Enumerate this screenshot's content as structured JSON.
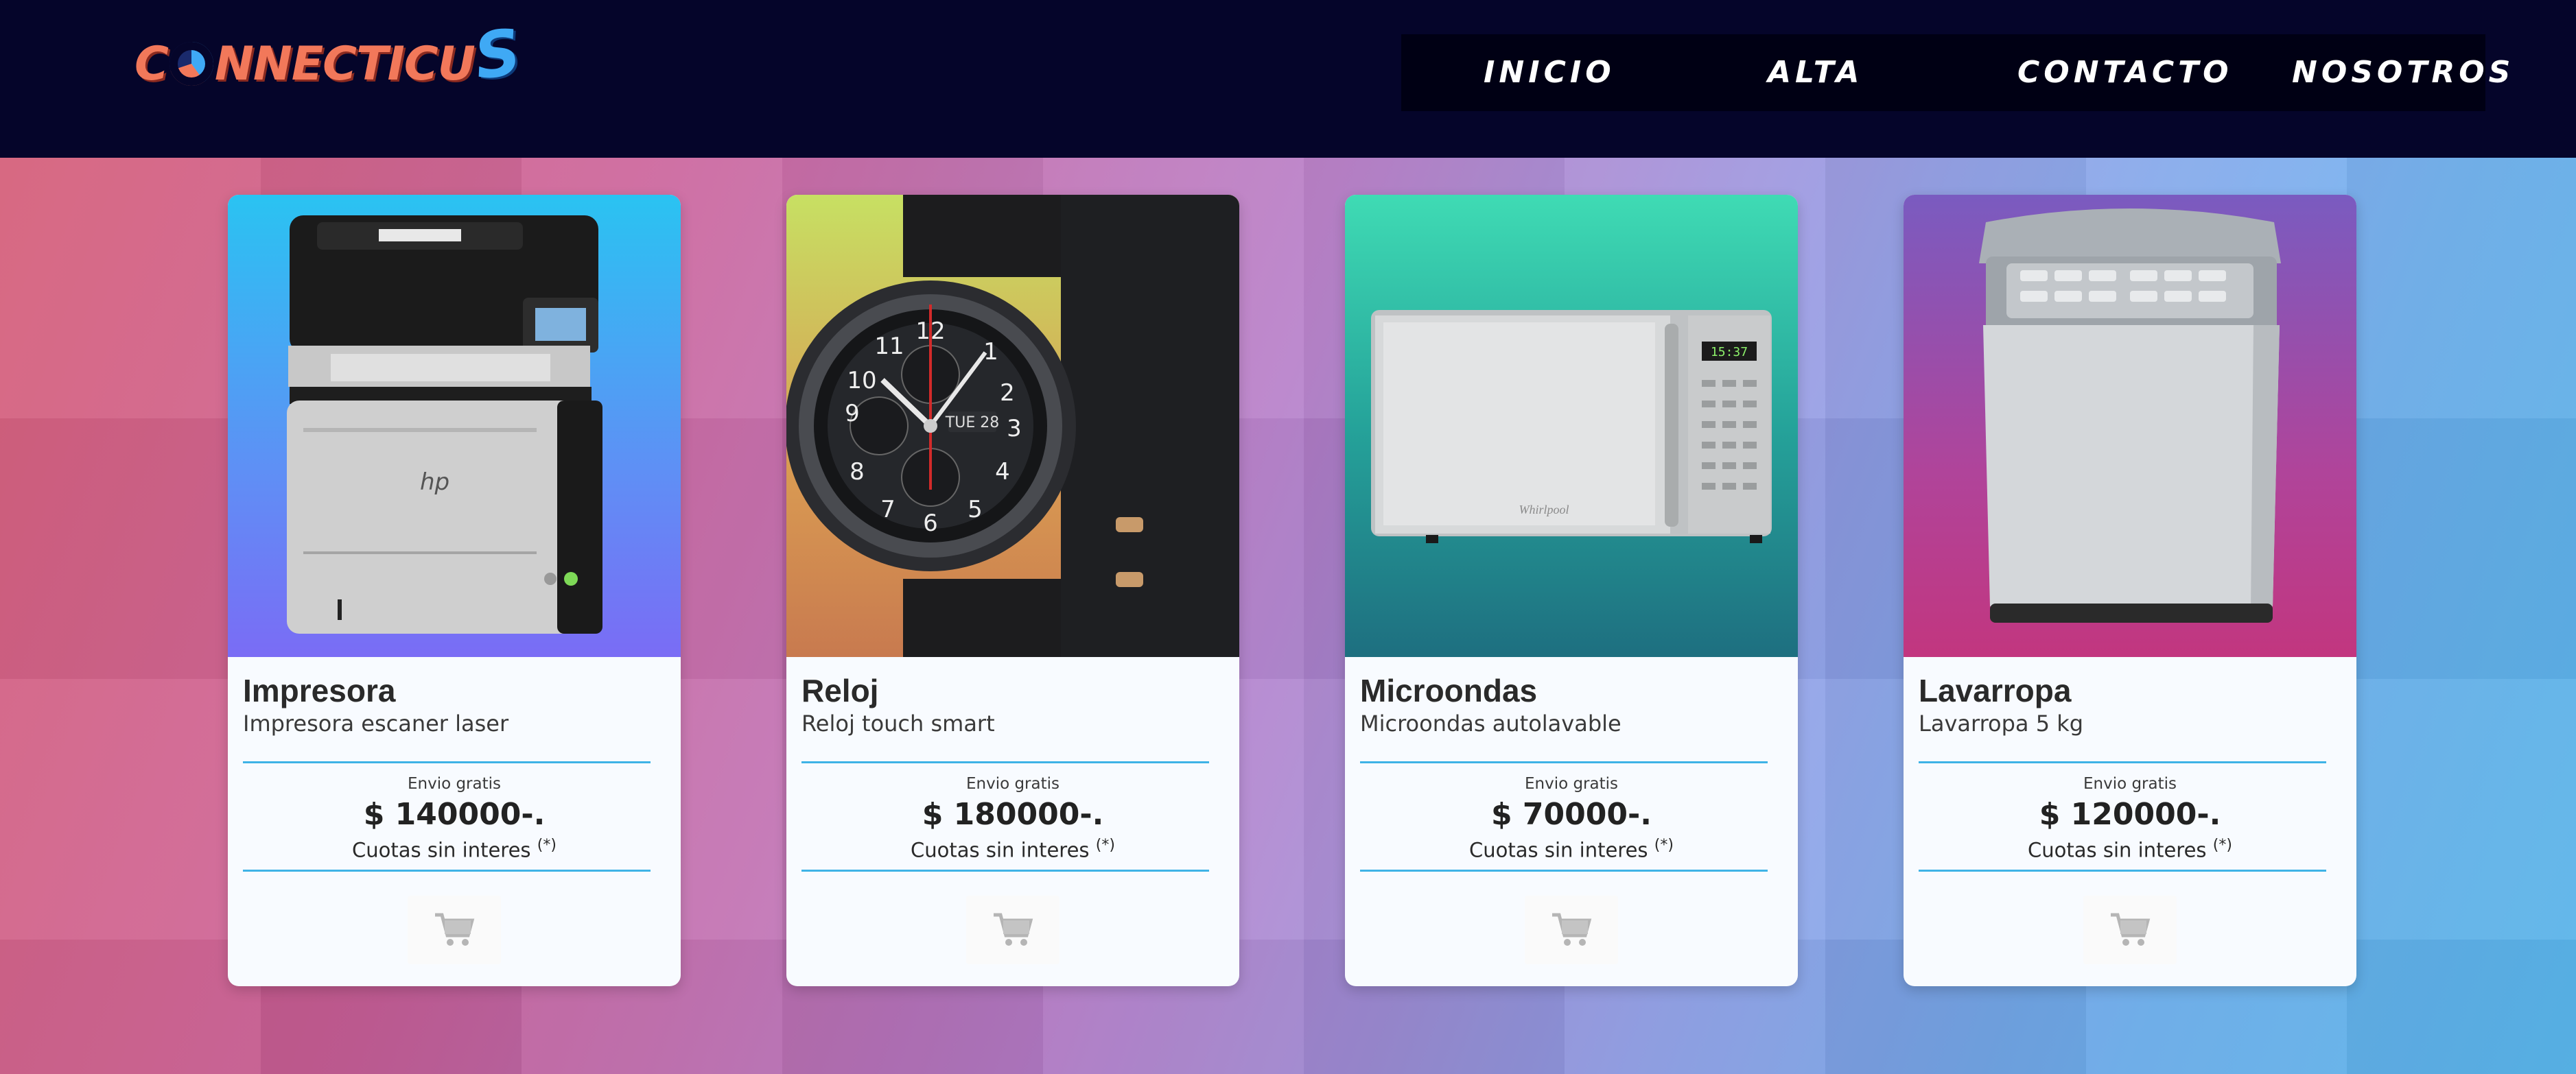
{
  "brand": {
    "name_main": "CONNECTICU",
    "name_accent": "S"
  },
  "nav": {
    "items": [
      {
        "label": "INICIO"
      },
      {
        "label": "ALTA"
      },
      {
        "label": "CONTACTO"
      },
      {
        "label": "NOSOTROS"
      }
    ]
  },
  "products": [
    {
      "title": "Impresora",
      "description": "Impresora escaner laser",
      "shipping": "Envio gratis",
      "price": "$ 140000-.",
      "installments": "Cuotas sin interes",
      "installments_note": "(*)",
      "image_icon": "printer-image"
    },
    {
      "title": "Reloj",
      "description": "Reloj touch smart",
      "shipping": "Envio gratis",
      "price": "$ 180000-.",
      "installments": "Cuotas sin interes",
      "installments_note": "(*)",
      "image_icon": "smartwatch-image",
      "watch_date": "TUE 28"
    },
    {
      "title": "Microondas",
      "description": "Microondas autolavable",
      "shipping": "Envio gratis",
      "price": "$ 70000-.",
      "installments": "Cuotas sin interes",
      "installments_note": "(*)",
      "image_icon": "microwave-image",
      "brand_label": "Whirlpool",
      "display_time": "15:37"
    },
    {
      "title": "Lavarropa",
      "description": "Lavarropa 5 kg",
      "shipping": "Envio gratis",
      "price": "$ 120000-.",
      "installments": "Cuotas sin interes",
      "installments_note": "(*)",
      "image_icon": "washing-machine-image"
    }
  ],
  "colors": {
    "header_bg": "#05052a",
    "nav_bg": "#000014",
    "divider": "#3fb3e6",
    "logo_primary": "#f2785a",
    "logo_accent": "#3fa9f5"
  },
  "icons": {
    "cart": "shopping-cart-icon"
  }
}
